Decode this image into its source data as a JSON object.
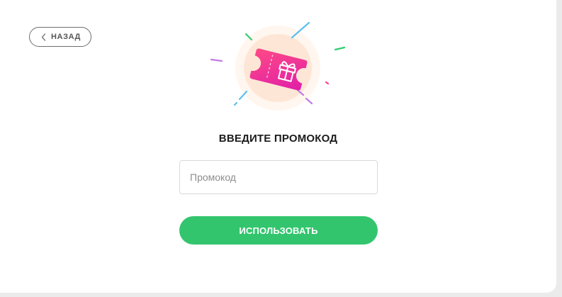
{
  "back_button": {
    "label": "НАЗАД",
    "icon": "chevron-left-icon"
  },
  "illustration": {
    "icon": "gift-ticket-icon",
    "colors": {
      "halo": "#fdeee3",
      "ticket_start": "#ff3d8b",
      "ticket_end": "#e61fa0",
      "sparkle_green": "#2ecc71",
      "sparkle_blue": "#4fb6e8",
      "sparkle_purple": "#c27be6"
    }
  },
  "promo": {
    "title": "ВВЕДИТЕ ПРОМОКОД",
    "placeholder": "Промокод",
    "value": ""
  },
  "submit_button": {
    "label": "ИСПОЛЬЗОВАТЬ",
    "color": "#33c56e"
  }
}
